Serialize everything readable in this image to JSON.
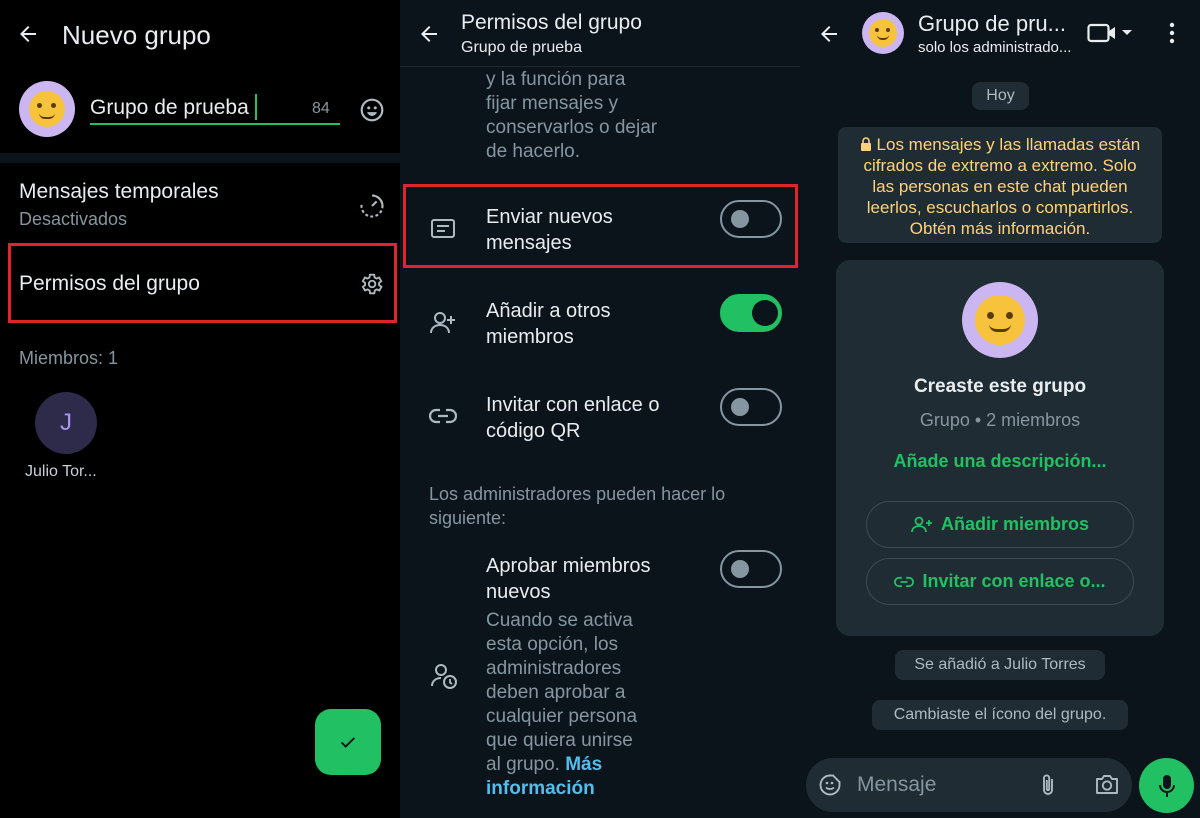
{
  "panel1": {
    "title": "Nuevo grupo",
    "group_name_value": "Grupo de prueba",
    "char_count": "84",
    "temp_messages": {
      "title": "Mensajes temporales",
      "status": "Desactivados"
    },
    "permissions": {
      "title": "Permisos del grupo"
    },
    "members_label": "Miembros: 1",
    "member": {
      "initial": "J",
      "name": "Julio Tor..."
    }
  },
  "panel2": {
    "header": {
      "title": "Permisos del grupo",
      "subtitle": "Grupo de prueba"
    },
    "top_text": [
      "y la función para",
      "fijar mensajes y",
      "conservarlos o dejar",
      "de hacerlo."
    ],
    "settings": [
      {
        "label_lines": [
          "Enviar nuevos",
          "mensajes"
        ],
        "enabled": false
      },
      {
        "label_lines": [
          "Añadir a otros",
          "miembros"
        ],
        "enabled": true
      },
      {
        "label_lines": [
          "Invitar con enlace o",
          "código QR"
        ],
        "enabled": false
      }
    ],
    "admins_label_lines": [
      "Los administradores pueden hacer lo",
      "siguiente:"
    ],
    "approve": {
      "label_lines": [
        "Aprobar miembros",
        "nuevos"
      ],
      "enabled": false,
      "desc_lines": [
        "Cuando se activa",
        "esta opción, los",
        "administradores",
        "deben aprobar a",
        "cualquier persona",
        "que quiera unirse",
        "al grupo."
      ],
      "more_link_1": "Más",
      "more_link_2": "información"
    }
  },
  "panel3": {
    "header": {
      "title": "Grupo de pru...",
      "subtitle": "solo los administrado..."
    },
    "date_chip": "Hoy",
    "encryption_lines": [
      "Los mensajes y las llamadas están",
      "cifrados de extremo a extremo. Solo",
      "las personas en este chat pueden",
      "leerlos, escucharlos o compartirlos.",
      "Obtén más información."
    ],
    "card": {
      "title": "Creaste este grupo",
      "subtitle": "Grupo • 2 miembros",
      "description_link": "Añade una descripción...",
      "add_members": "Añadir miembros",
      "invite_link": "Invitar con enlace o..."
    },
    "system_messages": [
      "Se añadió a Julio Torres",
      "Cambiaste el ícono del grupo."
    ],
    "composer_placeholder": "Mensaje"
  },
  "colors": {
    "accent": "#21c063",
    "highlight": "#e0242b",
    "link": "#53bdeb"
  }
}
